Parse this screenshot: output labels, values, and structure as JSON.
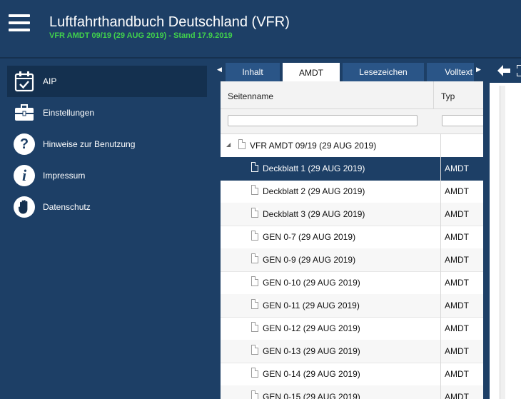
{
  "header": {
    "title": "Luftfahrthandbuch Deutschland (VFR)",
    "subtitle": "VFR AMDT 09/19 (29 AUG 2019) - Stand 17.9.2019"
  },
  "colors": {
    "primary": "#1d3f66",
    "accent_green": "#41d14c",
    "tab": "#2a5587"
  },
  "sidebar": {
    "items": [
      {
        "label": "AIP",
        "icon": "calendar-check-icon",
        "active": true
      },
      {
        "label": "Einstellungen",
        "icon": "briefcase-icon",
        "active": false
      },
      {
        "label": "Hinweise zur Benutzung",
        "icon": "question-circle-icon",
        "active": false
      },
      {
        "label": "Impressum",
        "icon": "info-circle-icon",
        "active": false
      },
      {
        "label": "Datenschutz",
        "icon": "hand-stop-icon",
        "active": false
      }
    ]
  },
  "tabs": [
    {
      "label": "Inhalt",
      "active": false
    },
    {
      "label": "AMDT",
      "active": true
    },
    {
      "label": "Lesezeichen",
      "active": false
    },
    {
      "label": "Volltext",
      "active": false
    }
  ],
  "table": {
    "columns": [
      "Seitenname",
      "Typ"
    ],
    "filter": {
      "name": "",
      "typ": ""
    },
    "group": {
      "name": "VFR AMDT 09/19 (29 AUG 2019)",
      "typ": "",
      "expander": "◢"
    },
    "rows": [
      {
        "name": "Deckblatt 1 (29 AUG 2019)",
        "typ": "AMDT",
        "selected": true
      },
      {
        "name": "Deckblatt 2 (29 AUG 2019)",
        "typ": "AMDT"
      },
      {
        "name": "Deckblatt 3 (29 AUG 2019)",
        "typ": "AMDT"
      },
      {
        "name": "GEN 0-7 (29 AUG 2019)",
        "typ": "AMDT"
      },
      {
        "name": "GEN 0-9 (29 AUG 2019)",
        "typ": "AMDT"
      },
      {
        "name": "GEN 0-10 (29 AUG 2019)",
        "typ": "AMDT"
      },
      {
        "name": "GEN 0-11 (29 AUG 2019)",
        "typ": "AMDT"
      },
      {
        "name": "GEN 0-12 (29 AUG 2019)",
        "typ": "AMDT"
      },
      {
        "name": "GEN 0-13 (29 AUG 2019)",
        "typ": "AMDT"
      },
      {
        "name": "GEN 0-14 (29 AUG 2019)",
        "typ": "AMDT"
      },
      {
        "name": "GEN 0-15 (29 AUG 2019)",
        "typ": "AMDT"
      }
    ]
  }
}
